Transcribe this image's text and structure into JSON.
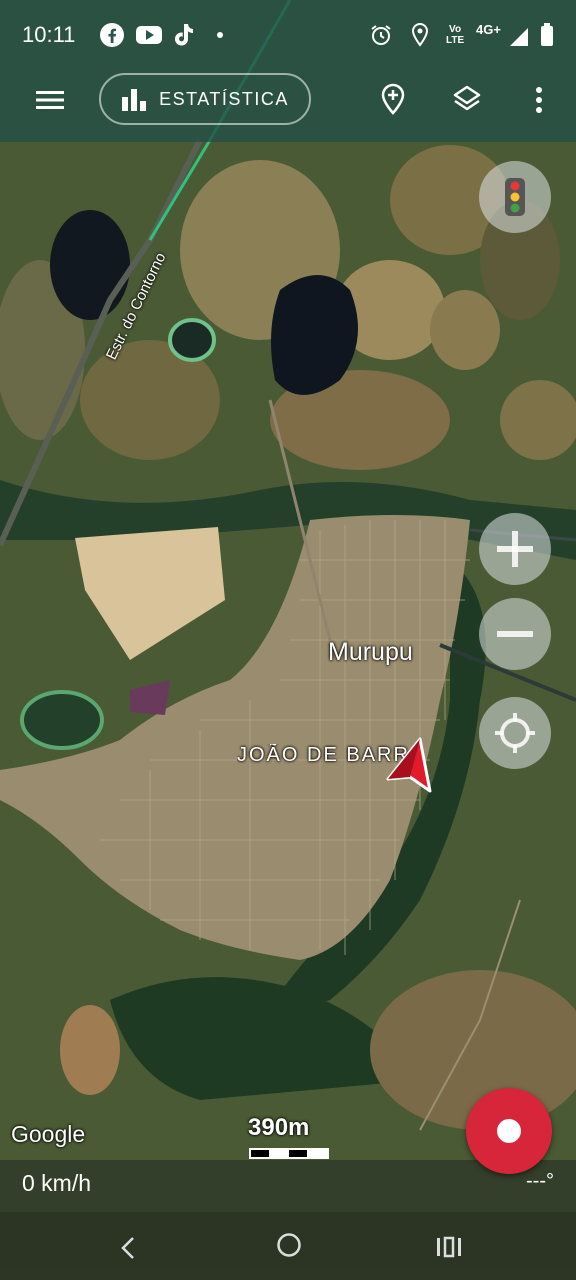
{
  "status_bar": {
    "time": "10:11",
    "notification_icons": [
      "facebook-icon",
      "youtube-icon",
      "tiktok-icon",
      "dot-icon"
    ],
    "system_icons": [
      "alarm-icon",
      "location-icon",
      "volte-icon",
      "network-icon",
      "signal-icon",
      "battery-icon"
    ],
    "volte_line1": "Vo",
    "volte_line2": "LTE",
    "network": "4G+"
  },
  "toolbar": {
    "statistics_label": "ESTATÍSTICA"
  },
  "map": {
    "road_label": "Estr. do Contorno",
    "place_labels": [
      "Murupu",
      "JOÃO DE BARRO"
    ],
    "attribution": "Google",
    "scale_label": "390m",
    "colors": {
      "accent_red": "#d7263a",
      "road_green": "#2ec27e",
      "toolbar_bg": "#234e48"
    }
  },
  "info": {
    "speed": "0 km/h",
    "heading": "---°"
  },
  "navbar": {
    "icons": [
      "back-icon",
      "home-icon",
      "recents-icon"
    ]
  }
}
